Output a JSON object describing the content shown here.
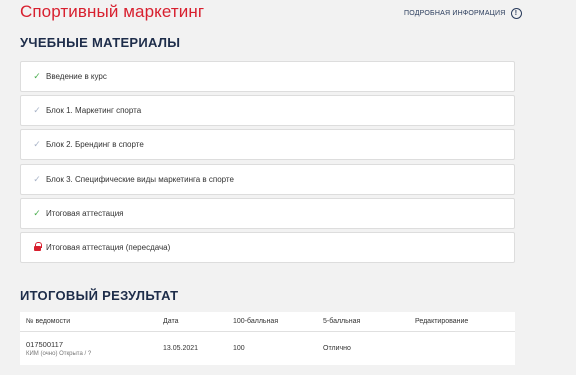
{
  "header": {
    "course_title": "Спортивный маркетинг",
    "more_info": "ПОДРОБНАЯ ИНФОРМАЦИЯ",
    "info_icon": "info-icon"
  },
  "materials": {
    "title": "УЧЕБНЫЕ МАТЕРИАЛЫ",
    "items": [
      {
        "label": "Введение в курс",
        "status": "completed"
      },
      {
        "label": "Блок 1. Маркетинг спорта",
        "status": "in-progress"
      },
      {
        "label": "Блок 2. Брендинг в спорте",
        "status": "in-progress"
      },
      {
        "label": "Блок 3. Специфические виды маркетинга в спорте",
        "status": "in-progress"
      },
      {
        "label": "Итоговая аттестация",
        "status": "completed"
      },
      {
        "label": "Итоговая аттестация (пересдача)",
        "status": "locked"
      }
    ]
  },
  "results": {
    "title": "ИТОГОВЫЙ РЕЗУЛЬТАТ",
    "columns": [
      "№ ведомости",
      "Дата",
      "100-балльная",
      "5-балльная",
      "Редактирование"
    ],
    "rows": [
      {
        "vedomost": "017500117",
        "vedomost_sub": "КИМ (очно) Открыта / ?",
        "date": "13.05.2021",
        "score100": "100",
        "score5": "Отлично",
        "edit": ""
      }
    ]
  },
  "colors": {
    "accent": "#d8202f",
    "heading": "#1e2d4a",
    "check": "#4caf50"
  }
}
